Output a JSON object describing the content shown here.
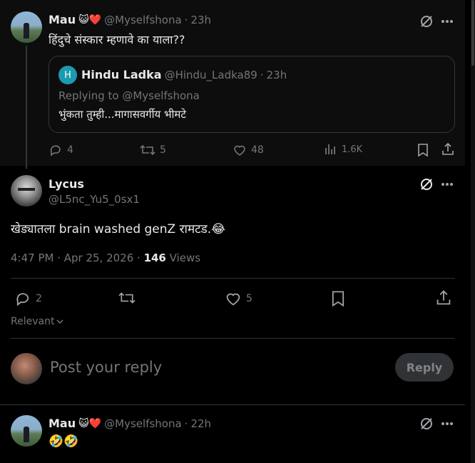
{
  "post1": {
    "name": "Mau",
    "emoji": "😺❤️",
    "handle": "@Myselfshona",
    "time": "23h",
    "text": "हिंदुचे संस्कार म्हणावे का याला??",
    "quote": {
      "avatar_letter": "H",
      "name": "Hindu Ladka",
      "handle": "@Hindu_Ladka89",
      "time": "23h",
      "replying_to": "Replying to @Myselfshona",
      "text": "भुंकता तुम्ही...मागासवर्गीय भीमटे"
    },
    "stats": {
      "replies": "4",
      "reposts": "5",
      "likes": "48",
      "views": "1.6K"
    }
  },
  "post2": {
    "name": "Lycus",
    "handle": "@L5nc_Yu5_0sx1",
    "text": "खेड्यातला brain washed genZ रामटड.😂",
    "timestamp": "4:47 PM · Apr 25, 2026 · ",
    "views_count": "146",
    "views_label": " Views",
    "stats": {
      "replies": "2",
      "likes": "5"
    }
  },
  "sort": {
    "label": "Relevant"
  },
  "reply_box": {
    "placeholder": "Post your reply",
    "button_label": "Reply"
  },
  "post3": {
    "name": "Mau",
    "emoji": "😺❤️",
    "handle": "@Myselfshona",
    "time": "22h",
    "text": "🤣🤣"
  },
  "colors": {
    "quote_avatar": "#1a9bb0",
    "reply_button_bg": "#2f3336"
  }
}
